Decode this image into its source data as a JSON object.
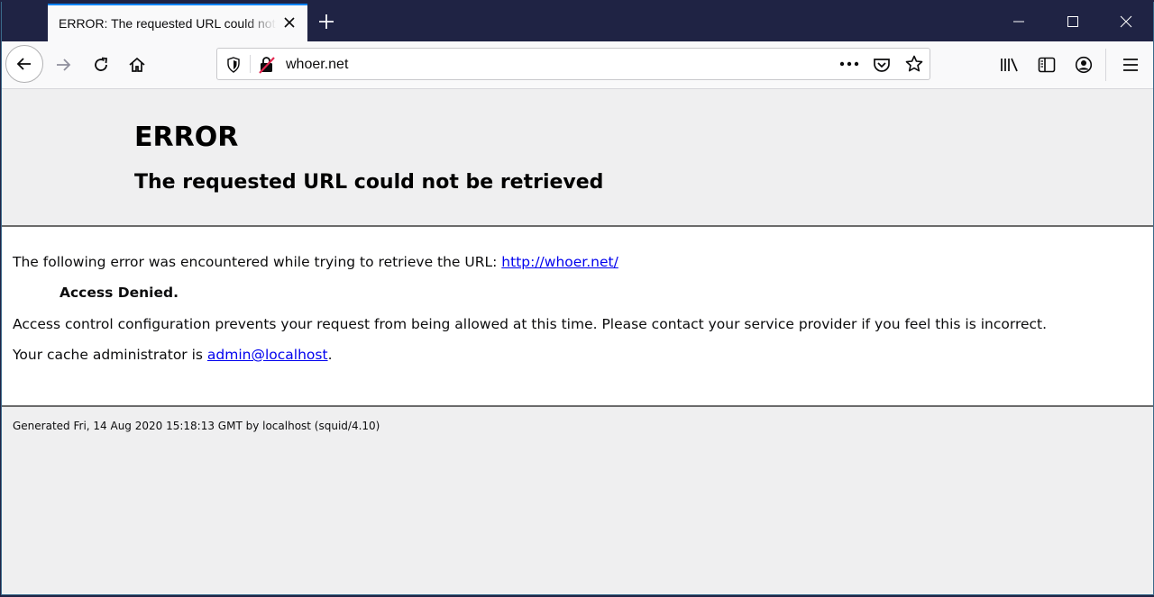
{
  "tab": {
    "title": "ERROR: The requested URL could not be retrieved"
  },
  "navbar": {
    "url": "whoer.net"
  },
  "page": {
    "title": "ERROR",
    "subtitle": "The requested URL could not be retrieved",
    "line1_prefix": "The following error was encountered while trying to retrieve the URL: ",
    "line1_link": "http://whoer.net/",
    "line2": "Access Denied.",
    "line3": "Access control configuration prevents your request from being allowed at this time. Please contact your service provider if you feel this is incorrect.",
    "line4_prefix": "Your cache administrator is ",
    "line4_link": "admin@localhost",
    "line4_suffix": ".",
    "footer": "Generated Fri, 14 Aug 2020 15:18:13 GMT by localhost (squid/4.10)"
  },
  "colors": {
    "tabstrip": "#1f2344",
    "accent": "#0a84ff",
    "link": "#0000ee"
  }
}
